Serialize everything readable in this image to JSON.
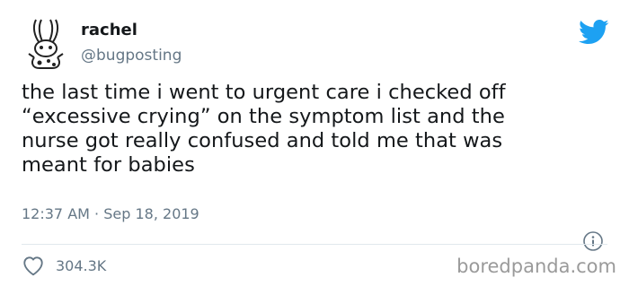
{
  "tweet": {
    "display_name": "rachel",
    "handle": "@bugposting",
    "text": "the last time i went to urgent care i checked off\n“excessive crying” on the symptom list and the\nnurse got really confused and told me that was\nmeant for babies",
    "time": "12:37 AM",
    "separator": "·",
    "date": "Sep 18, 2019",
    "likes": "304.3K"
  },
  "watermark": "boredpanda.com",
  "icons": {
    "brand": "twitter-bird-icon",
    "info": "info-icon",
    "like": "heart-icon"
  },
  "colors": {
    "twitter_blue": "#1da1f2",
    "secondary_text": "#657786",
    "primary_text": "#14171a"
  }
}
